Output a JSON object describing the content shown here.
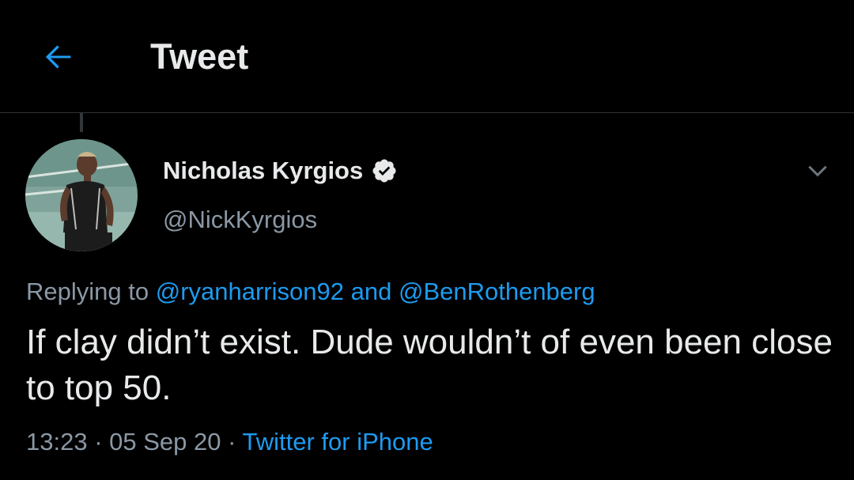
{
  "header": {
    "title": "Tweet",
    "back_icon": "arrow-left-icon",
    "accent_color": "#1d9bf0"
  },
  "tweet": {
    "author": {
      "display_name": "Nicholas Kyrgios",
      "handle": "@NickKyrgios",
      "verified": true,
      "verified_icon": "verified-badge-icon"
    },
    "menu_icon": "chevron-down-icon",
    "replying": {
      "prefix": "Replying to",
      "mention_1": "@ryanharrison92",
      "conjunction": "and",
      "mention_2": "@BenRothenberg"
    },
    "text": "If clay didn’t exist. Dude wouldn’t of even been close to top 50.",
    "time": "13:23",
    "separator": "·",
    "date": "05 Sep 20",
    "source": "Twitter for iPhone"
  },
  "colors": {
    "background": "#000000",
    "primary_text": "#e7e9ea",
    "secondary_text": "#8b98a5",
    "link": "#1d9bf0",
    "divider": "#2f3336"
  }
}
